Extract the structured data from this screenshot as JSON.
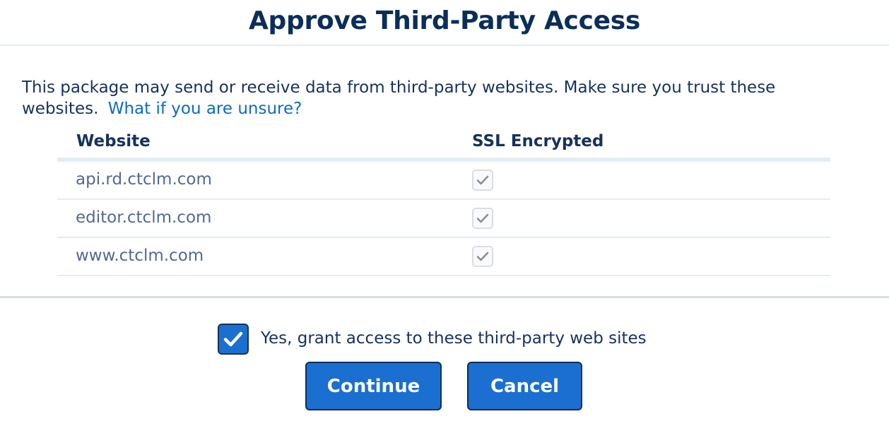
{
  "dialog": {
    "title": "Approve Third-Party Access",
    "description": "This package may send or receive data from third-party websites. Make sure you trust these websites.",
    "help_link": "What if you are unsure?"
  },
  "table": {
    "headers": {
      "website": "Website",
      "ssl": "SSL Encrypted"
    },
    "rows": [
      {
        "website": "api.rd.ctclm.com",
        "ssl_encrypted": true
      },
      {
        "website": "editor.ctclm.com",
        "ssl_encrypted": true
      },
      {
        "website": "www.ctclm.com",
        "ssl_encrypted": true
      }
    ]
  },
  "grant": {
    "label": "Yes, grant access to these third-party web sites",
    "checked": true
  },
  "buttons": {
    "continue": "Continue",
    "cancel": "Cancel"
  },
  "colors": {
    "brand_blue": "#1b6fd0",
    "title_navy": "#0b2e59",
    "link_blue": "#0b6bc2",
    "muted_text": "#54698d"
  }
}
